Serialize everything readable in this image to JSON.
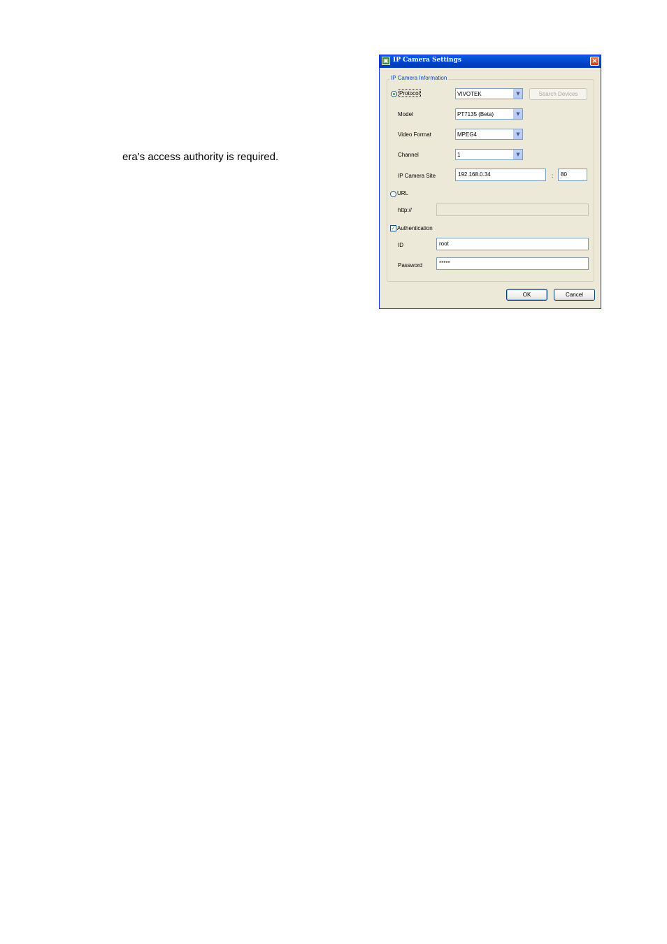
{
  "body_text": "era’s access authority is required.",
  "dialog": {
    "title": "IP Camera Settings",
    "close_symbol": "×",
    "group_title": "IP Camera Information",
    "protocol": {
      "label": "Protocol",
      "selected": true,
      "value": "VIVOTEK",
      "search_button": "Search Devices"
    },
    "model": {
      "label": "Model",
      "value": "PT7135 (Beta)"
    },
    "video_format": {
      "label": "Video Format",
      "value": "MPEG4"
    },
    "channel": {
      "label": "Channel",
      "value": "1"
    },
    "ip_camera_site": {
      "label": "IP Camera Site",
      "ip": "192.168.0.34",
      "separator": ":",
      "port": "80"
    },
    "url": {
      "label": "URL",
      "selected": false,
      "prefix_label": "http://",
      "value": ""
    },
    "authentication": {
      "label": "Authentication",
      "checked": true,
      "id_label": "ID",
      "id_value": "root",
      "password_label": "Password",
      "password_value": "*****"
    },
    "ok_button": "OK",
    "cancel_button": "Cancel"
  },
  "icons": {
    "title": "camera-settings-icon",
    "close": "close-icon",
    "dropdown": "chevron-down-icon",
    "check": "check-icon"
  }
}
